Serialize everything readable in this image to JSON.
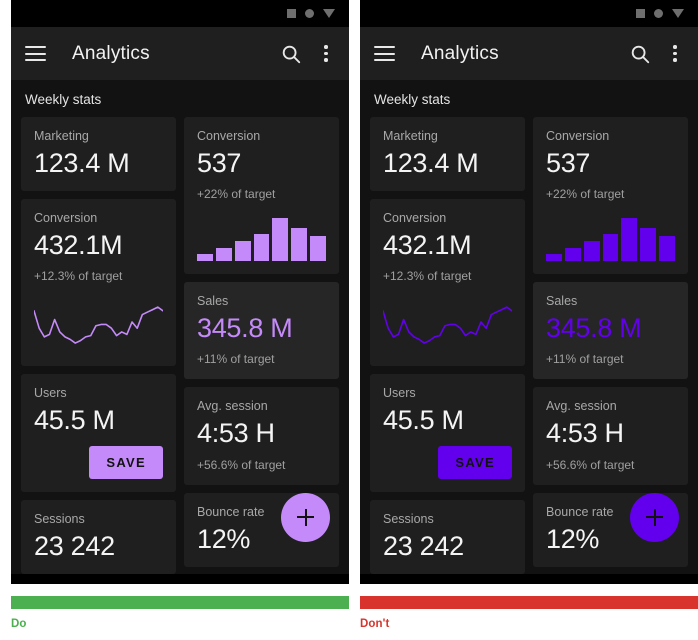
{
  "panels": [
    {
      "id": "do",
      "verdict": "Do",
      "verdict_color": "#4CAF50",
      "accent": "#C58AF9",
      "accent_text": "#C58AF9",
      "on_accent": "#121212",
      "statusbar": {
        "icons": [
          "square-icon",
          "circle-icon",
          "triangle-icon"
        ]
      },
      "appbar": {
        "menu_label": "menu-icon",
        "title": "Analytics",
        "search_label": "search-icon",
        "more_label": "more-vert-icon"
      },
      "section_title": "Weekly stats",
      "left_cards": [
        {
          "label": "Marketing",
          "value": "123.4 M",
          "sub": "",
          "chart": "none",
          "highlight": false
        },
        {
          "label": "Conversion",
          "value": "432.1M",
          "sub": "+12.3% of target",
          "chart": "line",
          "highlight": false
        },
        {
          "label": "Users",
          "value": "45.5 M",
          "sub": "",
          "chart": "none",
          "highlight": false,
          "button": "SAVE"
        },
        {
          "label": "Sessions",
          "value": "23 242",
          "sub": "",
          "chart": "none",
          "highlight": false
        }
      ],
      "right_cards": [
        {
          "label": "Conversion",
          "value": "537",
          "sub": "+22% of target",
          "chart": "bars",
          "highlight": false
        },
        {
          "label": "Sales",
          "value": "345.8 M",
          "sub": "+11% of target",
          "chart": "none",
          "highlight": true,
          "value_accent": true
        },
        {
          "label": "Avg. session",
          "value": "4:53 H",
          "sub": "+56.6% of target",
          "chart": "none",
          "highlight": false
        },
        {
          "label": "Bounce rate",
          "value": "12%",
          "sub": "",
          "chart": "none",
          "highlight": false
        }
      ],
      "fab_label": "add-icon"
    },
    {
      "id": "dont",
      "verdict": "Don't",
      "verdict_color": "#D8332C",
      "accent": "#6200EE",
      "accent_text": "#6200EE",
      "on_accent": "#121212",
      "statusbar": {
        "icons": [
          "square-icon",
          "circle-icon",
          "triangle-icon"
        ]
      },
      "appbar": {
        "menu_label": "menu-icon",
        "title": "Analytics",
        "search_label": "search-icon",
        "more_label": "more-vert-icon"
      },
      "section_title": "Weekly stats",
      "left_cards": [
        {
          "label": "Marketing",
          "value": "123.4 M",
          "sub": "",
          "chart": "none",
          "highlight": false
        },
        {
          "label": "Conversion",
          "value": "432.1M",
          "sub": "+12.3% of target",
          "chart": "line",
          "highlight": false
        },
        {
          "label": "Users",
          "value": "45.5 M",
          "sub": "",
          "chart": "none",
          "highlight": false,
          "button": "SAVE"
        },
        {
          "label": "Sessions",
          "value": "23 242",
          "sub": "",
          "chart": "none",
          "highlight": false
        }
      ],
      "right_cards": [
        {
          "label": "Conversion",
          "value": "537",
          "sub": "+22% of target",
          "chart": "bars",
          "highlight": false
        },
        {
          "label": "Sales",
          "value": "345.8 M",
          "sub": "+11% of target",
          "chart": "none",
          "highlight": true,
          "value_accent": true
        },
        {
          "label": "Avg. session",
          "value": "4:53 H",
          "sub": "+56.6% of target",
          "chart": "none",
          "highlight": false
        },
        {
          "label": "Bounce rate",
          "value": "12%",
          "sub": "",
          "chart": "none",
          "highlight": false
        }
      ],
      "fab_label": "add-icon"
    }
  ],
  "chart_data": [
    {
      "type": "bar",
      "title": "Conversion",
      "categories": [
        "1",
        "2",
        "3",
        "4",
        "5",
        "6",
        "7"
      ],
      "values": [
        12,
        22,
        34,
        45,
        72,
        56,
        42
      ],
      "ylim": [
        0,
        80
      ],
      "xlabel": "",
      "ylabel": "",
      "grid": false,
      "legend": "none"
    },
    {
      "type": "line",
      "title": "Conversion",
      "x": [
        0,
        1,
        2,
        3,
        4,
        5,
        6,
        7,
        8,
        9,
        10,
        11,
        12,
        13,
        14,
        15,
        16,
        17,
        18,
        19,
        20,
        21,
        22,
        23,
        24,
        25
      ],
      "values": [
        68,
        40,
        26,
        30,
        54,
        34,
        26,
        22,
        16,
        20,
        26,
        28,
        44,
        46,
        46,
        40,
        28,
        34,
        30,
        50,
        40,
        62,
        66,
        70,
        74,
        68
      ],
      "ylim": [
        0,
        100
      ],
      "xlabel": "",
      "ylabel": "",
      "grid": false,
      "legend": "none"
    }
  ]
}
